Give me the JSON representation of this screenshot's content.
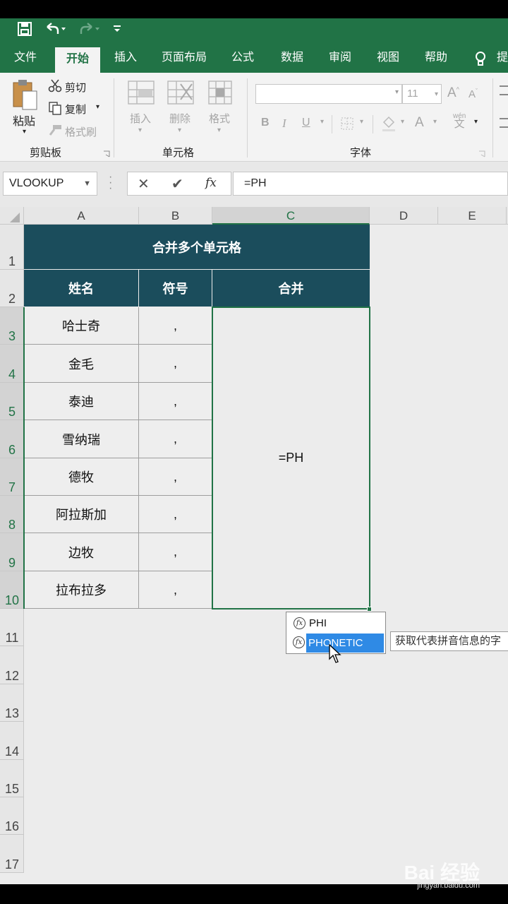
{
  "quick_access": {
    "save_icon": "save-icon",
    "undo_icon": "undo-icon",
    "redo_icon": "redo-icon",
    "customize_icon": "customize-icon"
  },
  "tabs": [
    "文件",
    "开始",
    "插入",
    "页面布局",
    "公式",
    "数据",
    "审阅",
    "视图",
    "帮助",
    "提"
  ],
  "active_tab": "开始",
  "ribbon": {
    "paste": "粘贴",
    "cut": "剪切",
    "copy": "复制",
    "format_painter": "格式刷",
    "clipboard_group": "剪贴板",
    "insert": "插入",
    "delete": "删除",
    "format": "格式",
    "cells_group": "单元格",
    "font_size": "11",
    "bold": "B",
    "italic": "I",
    "underline": "U",
    "font_color_letter": "A",
    "wen": "wén",
    "wen_char": "文",
    "font_group": "字体"
  },
  "formula_bar": {
    "name_box": "VLOOKUP",
    "cancel": "✕",
    "enter": "✔",
    "fx": "fx",
    "content": "=PH"
  },
  "columns": [
    "A",
    "B",
    "C",
    "D",
    "E"
  ],
  "rows": [
    "1",
    "2",
    "3",
    "4",
    "5",
    "6",
    "7",
    "8",
    "9",
    "10",
    "11",
    "12",
    "13",
    "14",
    "15",
    "16",
    "17"
  ],
  "table": {
    "title": "合并多个单元格",
    "headers": [
      "姓名",
      "符号",
      "合并"
    ],
    "names": [
      "哈士奇",
      "金毛",
      "泰迪",
      "雪纳瑞",
      "德牧",
      "阿拉斯加",
      "边牧",
      "拉布拉多"
    ],
    "symbols": [
      ",",
      ",",
      ",",
      ",",
      ",",
      ",",
      ",",
      ","
    ],
    "merged_value": "=PH"
  },
  "autocomplete": {
    "items": [
      "PHI",
      "PHONETIC"
    ],
    "selected": "PHONETIC",
    "tooltip": "获取代表拼音信息的字"
  },
  "watermark": {
    "brand": "Bai 经验",
    "url": "jingyan.baidu.com"
  },
  "colors": {
    "excel_green": "#217346",
    "header_fill": "#1b4d5c",
    "selection": "#2f8ae5"
  }
}
